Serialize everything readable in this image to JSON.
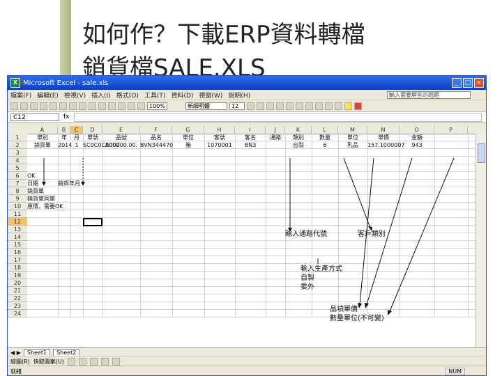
{
  "slide": {
    "title_line1": "如何作？下載ERP資料轉檔",
    "title_line2": "銷貨檔SALE.XLS"
  },
  "window": {
    "title": "Microsoft Excel - sale.xls",
    "minimize": "_",
    "maximize": "□",
    "close": "×"
  },
  "menubar": {
    "items": [
      "檔案(F)",
      "編輯(E)",
      "檢視(V)",
      "插入(I)",
      "格式(O)",
      "工具(T)",
      "資料(D)",
      "視窗(W)",
      "說明(H)"
    ]
  },
  "toolbar": {
    "font": "新細明體",
    "size": "12",
    "help_placeholder": "輸入需要解答的問題",
    "zoom": "100%"
  },
  "formula_bar": {
    "name_box": "C12",
    "fx": "fx"
  },
  "grid": {
    "columns": [
      "A",
      "B",
      "C",
      "D",
      "E",
      "F",
      "G",
      "H",
      "I",
      "J",
      "K",
      "L",
      "M",
      "N",
      "O",
      "P"
    ],
    "rows": [
      "1",
      "2",
      "3",
      "4",
      "5",
      "6",
      "7",
      "8",
      "9",
      "10",
      "11",
      "12",
      "13",
      "14",
      "15",
      "16",
      "17",
      "18",
      "19",
      "20",
      "21",
      "22",
      "23",
      "24"
    ],
    "row1": [
      "單別",
      "年",
      "月",
      "單號",
      "品號",
      "品名",
      "單位",
      "客號",
      "客名",
      "通路",
      "類別",
      "數量",
      "單位",
      "單價",
      "金額"
    ],
    "row2": [
      "銷貨單",
      "2014",
      "1",
      "SC0C0C0002",
      "A00000.00.",
      "BVN344470",
      "箱",
      "1070001",
      "BN3",
      "",
      "台製",
      "6",
      "乳品",
      "157.1000007",
      "943"
    ],
    "rowA6": "OK",
    "rowA7": "日期",
    "rowB7": "銷貨年月",
    "rowA8": "銷貨單",
    "rowA9": "銷貨單同單",
    "rowA10": "原價，需要OK"
  },
  "annotations": {
    "channel_code": "輸入通路代號",
    "customer_category": "客戶類別",
    "note_line1": "輸入生產方式",
    "note_line2": "自製",
    "note_line3": "委外",
    "price_line1": "品項單價",
    "price_line2": "數量單位(不可變)"
  },
  "sheet_tabs": [
    "Sheet1",
    "Sheet2"
  ],
  "drawbar": {
    "draw": "繪圖(R)",
    "autoshapes": "快取圖案(U)"
  },
  "statusbar": {
    "ready": "就緒",
    "num": "NUM"
  }
}
